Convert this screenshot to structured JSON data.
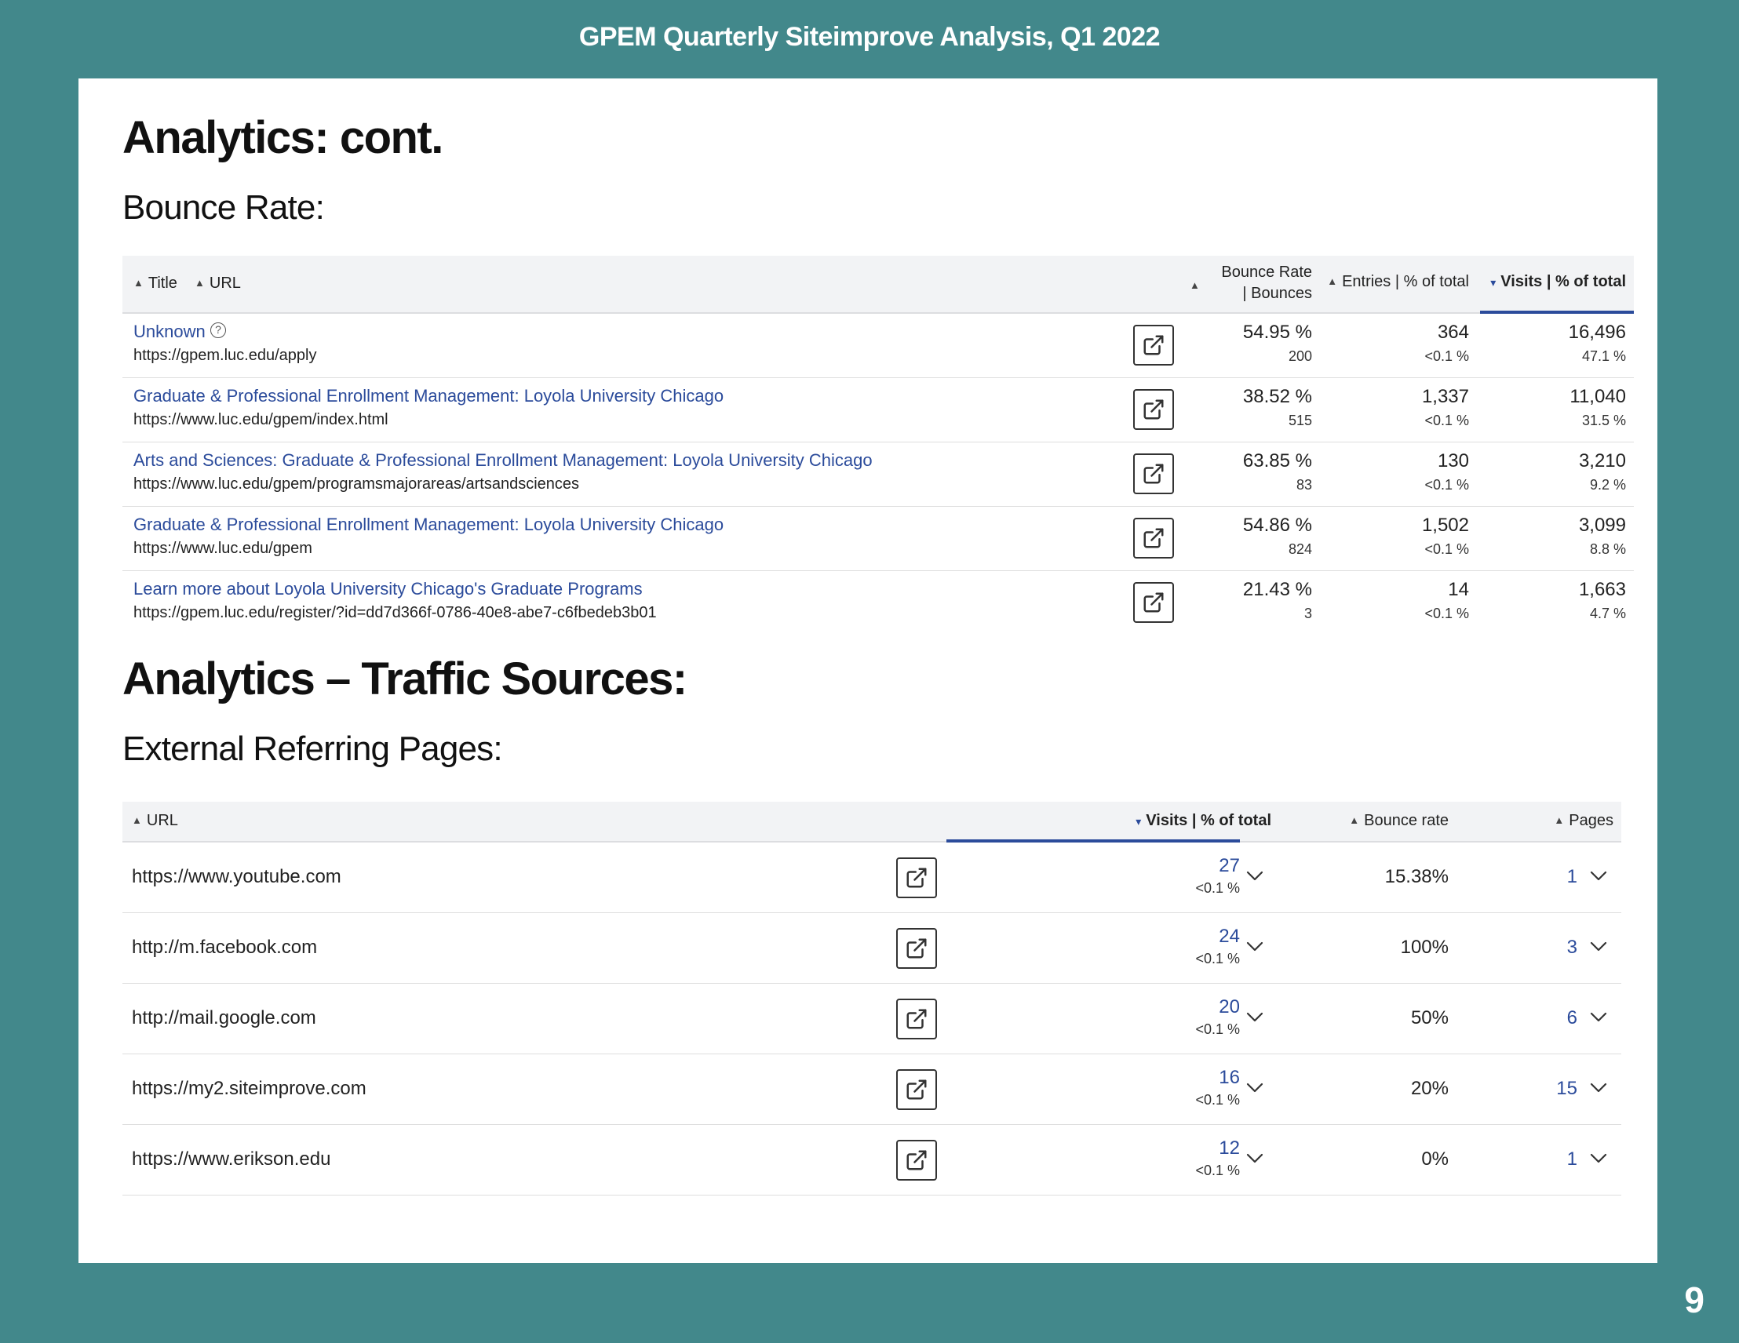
{
  "header": {
    "title": "GPEM Quarterly Siteimprove Analysis, Q1 2022"
  },
  "page_number": "9",
  "section1": {
    "heading": "Analytics: cont.",
    "subheading": "Bounce Rate:",
    "columns": {
      "title": "Title",
      "url": "URL",
      "bounce_line1": "Bounce Rate",
      "bounce_line2": "| Bounces",
      "entries": "Entries | % of total",
      "visits": "Visits | % of total"
    },
    "rows": [
      {
        "title": "Unknown",
        "url": "https://gpem.luc.edu/apply",
        "bounce_rate": "54.95 %",
        "bounces": "200",
        "entries": "364",
        "entries_pct": "<0.1 %",
        "visits": "16,496",
        "visits_pct": "47.1 %"
      },
      {
        "title": "Graduate & Professional Enrollment Management: Loyola University Chicago",
        "url": "https://www.luc.edu/gpem/index.html",
        "bounce_rate": "38.52 %",
        "bounces": "515",
        "entries": "1,337",
        "entries_pct": "<0.1 %",
        "visits": "11,040",
        "visits_pct": "31.5 %"
      },
      {
        "title": "Arts and Sciences: Graduate & Professional Enrollment Management: Loyola University Chicago",
        "url": "https://www.luc.edu/gpem/programsmajorareas/artsandsciences",
        "bounce_rate": "63.85 %",
        "bounces": "83",
        "entries": "130",
        "entries_pct": "<0.1 %",
        "visits": "3,210",
        "visits_pct": "9.2 %"
      },
      {
        "title": "Graduate & Professional Enrollment Management: Loyola University Chicago",
        "url": "https://www.luc.edu/gpem",
        "bounce_rate": "54.86 %",
        "bounces": "824",
        "entries": "1,502",
        "entries_pct": "<0.1 %",
        "visits": "3,099",
        "visits_pct": "8.8 %"
      },
      {
        "title": "Learn more about Loyola University Chicago's Graduate Programs",
        "url": "https://gpem.luc.edu/register/?id=dd7d366f-0786-40e8-abe7-c6fbedeb3b01",
        "bounce_rate": "21.43 %",
        "bounces": "3",
        "entries": "14",
        "entries_pct": "<0.1 %",
        "visits": "1,663",
        "visits_pct": "4.7 %"
      }
    ]
  },
  "section2": {
    "heading": "Analytics – Traffic Sources:",
    "subheading": "External Referring Pages:",
    "columns": {
      "url": "URL",
      "visits": "Visits | % of total",
      "bounce": "Bounce rate",
      "pages": "Pages"
    },
    "rows": [
      {
        "url": "https://www.youtube.com",
        "visits": "27",
        "visits_pct": "<0.1 %",
        "bounce": "15.38%",
        "pages": "1"
      },
      {
        "url": "http://m.facebook.com",
        "visits": "24",
        "visits_pct": "<0.1 %",
        "bounce": "100%",
        "pages": "3"
      },
      {
        "url": "http://mail.google.com",
        "visits": "20",
        "visits_pct": "<0.1 %",
        "bounce": "50%",
        "pages": "6"
      },
      {
        "url": "https://my2.siteimprove.com",
        "visits": "16",
        "visits_pct": "<0.1 %",
        "bounce": "20%",
        "pages": "15"
      },
      {
        "url": "https://www.erikson.edu",
        "visits": "12",
        "visits_pct": "<0.1 %",
        "bounce": "0%",
        "pages": "1"
      }
    ]
  }
}
